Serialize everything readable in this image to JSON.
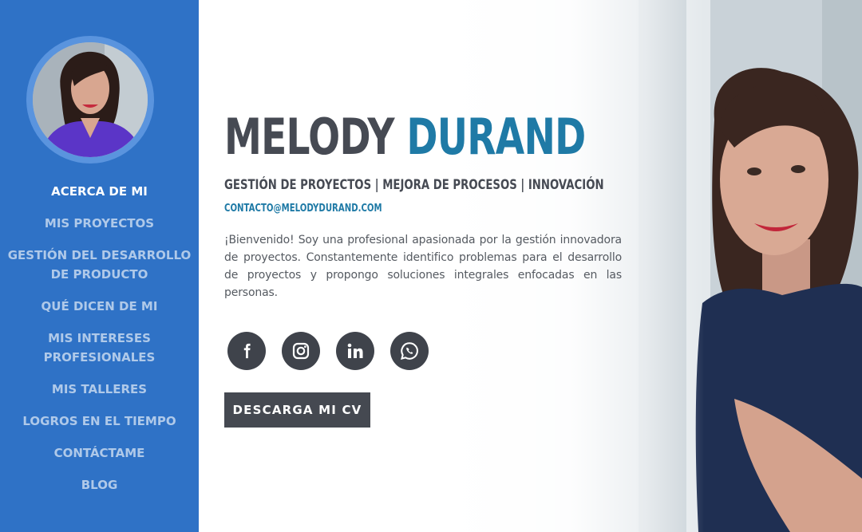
{
  "sidebar": {
    "items": [
      {
        "label": "ACERCA DE MI",
        "active": true
      },
      {
        "label": "MIS PROYECTOS",
        "active": false
      },
      {
        "label": "GESTIÓN DEL DESARROLLO DE PRODUCTO",
        "active": false
      },
      {
        "label": "QUÉ DICEN DE MI",
        "active": false
      },
      {
        "label": "MIS INTERESES PROFESIONALES",
        "active": false
      },
      {
        "label": "MIS TALLERES",
        "active": false
      },
      {
        "label": "LOGROS EN EL TIEMPO",
        "active": false
      },
      {
        "label": "CONTÁCTAME",
        "active": false
      },
      {
        "label": "BLOG",
        "active": false
      }
    ]
  },
  "hero": {
    "first_name": "MELODY",
    "last_name": "DURAND",
    "tagline": "GESTIÓN DE PROYECTOS | MEJORA DE PROCESOS | INNOVACIÓN",
    "email": "CONTACTO@MELODYDURAND.COM",
    "intro": "¡Bienvenido! Soy una profesional apasionada por la gestión innovadora de proyectos. Constantemente identifico problemas para el desarrollo de proyectos y propongo soluciones integrales enfocadas en las personas.",
    "cv_button": "DESCARGA MI CV"
  },
  "socials": [
    {
      "icon": "facebook-icon"
    },
    {
      "icon": "instagram-icon"
    },
    {
      "icon": "linkedin-icon"
    },
    {
      "icon": "whatsapp-icon"
    }
  ],
  "colors": {
    "sidebar": "#2f72c6",
    "accent": "#1f7aa6",
    "dark": "#464a53"
  }
}
